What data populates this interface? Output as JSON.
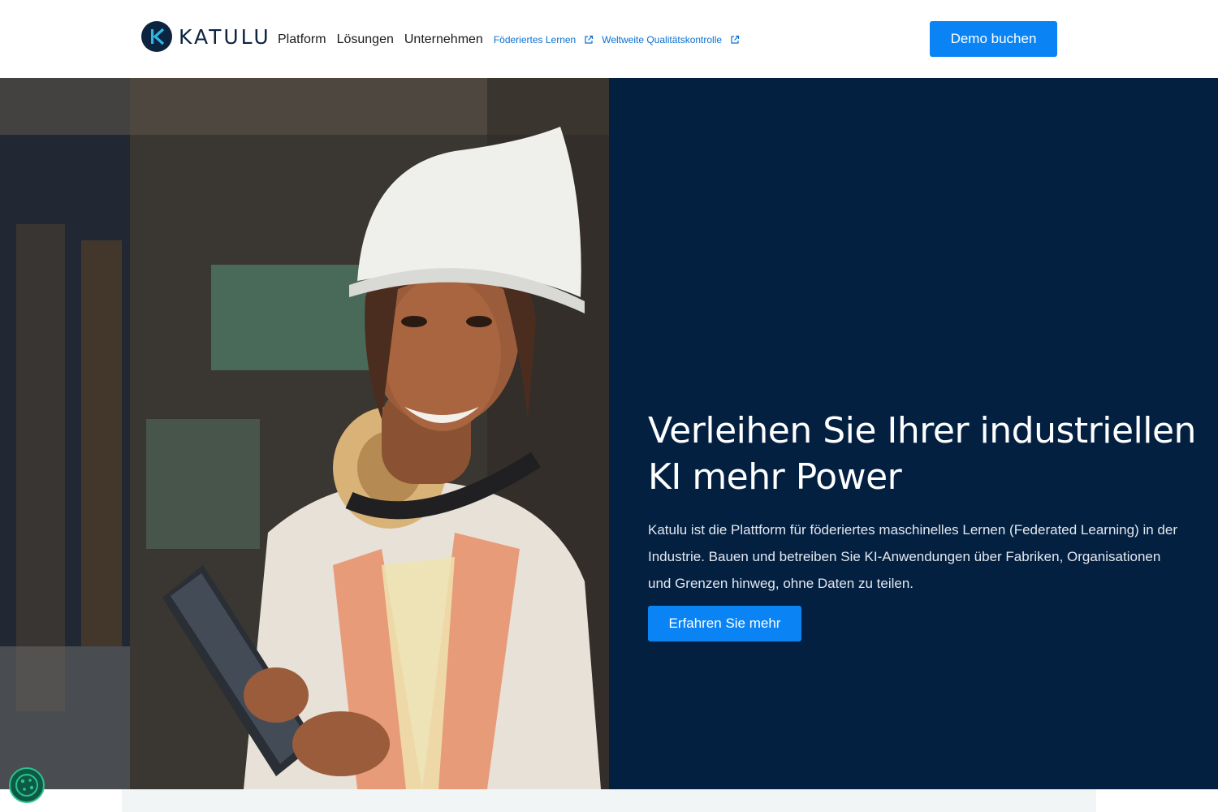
{
  "header": {
    "logo_text": "KATULU",
    "nav": {
      "platform": "Platform",
      "solutions": "Lösungen",
      "company": "Unternehmen",
      "federated": "Föderiertes Lernen",
      "quality": "Weltweite Qualitätskontrolle"
    },
    "demo_button": "Demo buchen"
  },
  "hero": {
    "title_line1": "Verleihen Sie Ihrer industriellen",
    "title_line2": "KI mehr Power",
    "description": "Katulu ist die Plattform für föderiertes maschinelles Lernen (Federated Learning) in der Industrie. Bauen und betreiben Sie KI-Anwendungen über Fabriken, Organisationen und Grenzen hinweg, ohne Daten zu teilen.",
    "cta_button": "Erfahren Sie mehr",
    "photo_subject": "worker-with-hardhat-and-tablet"
  },
  "icons": {
    "logo": "katulu-k-logo-icon",
    "external": "external-link-icon",
    "cookie": "cookie-icon"
  },
  "colors": {
    "brand_navy": "#032041",
    "accent_blue": "#0a84f5",
    "link_blue": "#0a6fd1",
    "cookie_green": "#2bc48a"
  }
}
